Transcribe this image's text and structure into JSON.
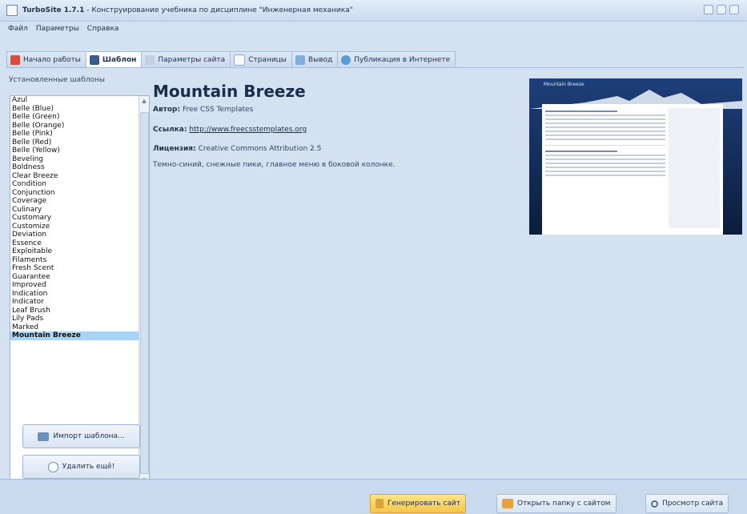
{
  "window": {
    "app_name": "TurboSite 1.7.1",
    "subtitle": " - Конструирование учебника по дисциплине \"Инженерная механика\""
  },
  "menu": [
    "Файл",
    "Параметры",
    "Справка"
  ],
  "tabs": [
    {
      "label": "Начало работы",
      "icon": "home-icon"
    },
    {
      "label": "Шаблон",
      "icon": "brush-icon",
      "active": true
    },
    {
      "label": "Параметры сайта",
      "icon": "settings-icon"
    },
    {
      "label": "Страницы",
      "icon": "pages-icon"
    },
    {
      "label": "Вывод",
      "icon": "output-icon"
    },
    {
      "label": "Публикация в Интернете",
      "icon": "globe-icon"
    }
  ],
  "sidebar": {
    "title": "Установленные шаблоны",
    "templates": [
      "Azul",
      "Belle (Blue)",
      "Belle (Green)",
      "Belle (Orange)",
      "Belle (Pink)",
      "Belle (Red)",
      "Belle (Yellow)",
      "Beveling",
      "Boldness",
      "Clear Breeze",
      "Condition",
      "Conjunction",
      "Coverage",
      "Culinary",
      "Customary",
      "Customize",
      "Deviation",
      "Essence",
      "Exploitable",
      "Filaments",
      "Fresh Scent",
      "Guarantee",
      "Improved",
      "Indication",
      "Indicator",
      "Leaf Brush",
      "Lily Pads",
      "Marked",
      "Mountain Breeze"
    ],
    "selected": "Mountain Breeze",
    "import_button": "Импорт шаблона...",
    "remove_button": "Удалить ещё!"
  },
  "template": {
    "name": "Mountain Breeze",
    "author_label": "Автор:",
    "author": "Free CSS Templates",
    "link_label": "Ссылка:",
    "link": "http://www.freecsstemplates.org",
    "license_label": "Лицензия:",
    "license": "Creative Commons Attribution 2.5",
    "description": "Темно-синий, снежные пики, главное меню в боковой колонке.",
    "preview_title": "Mountain Breeze"
  },
  "footer": {
    "generate_button": "Генерировать сайт",
    "open_folder_button": "Открыть папку с сайтом",
    "view_button": "Просмотр сайта"
  },
  "colors": {
    "accent": "#f6c64a",
    "selection": "#a9d4f5",
    "panel": "#d4e1f1"
  }
}
